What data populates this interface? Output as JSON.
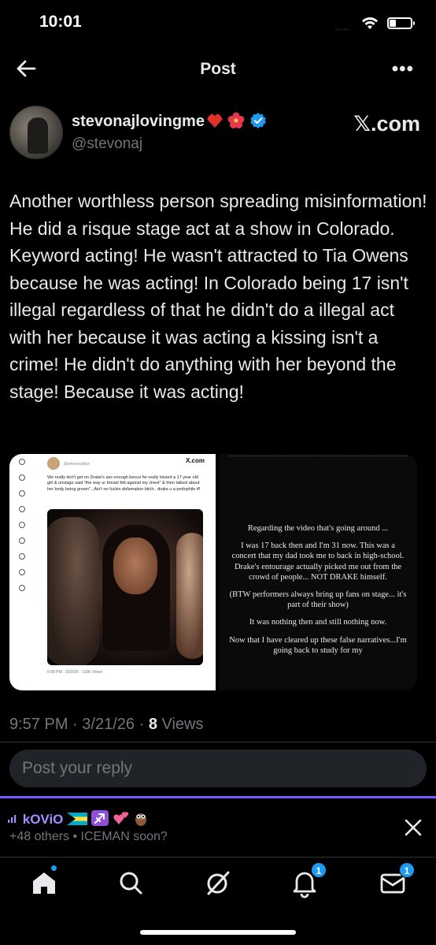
{
  "status_bar": {
    "time": "10:01",
    "signal_dots": "....."
  },
  "nav": {
    "title": "Post",
    "more": "•••"
  },
  "author": {
    "display_name": "stevonajlovingme",
    "handle": "@stevonaj",
    "source_badge": "𝕏.com",
    "name_emojis": [
      "red-heart",
      "hibiscus"
    ]
  },
  "tweet": {
    "text": "Another worthless person spreading misinformation! He did a risque stage act at a show in Colorado. Keyword acting! He wasn't attracted to Tia Owens because he was acting! In Colorado being 17 isn't illegal regardless of that he didn't do a illegal act with her because it was acting a kissing isn't a crime!  He didn't do anything with her beyond the stage! Because it was acting!"
  },
  "media_left": {
    "handle": "@shesroyaltyx",
    "source": "X.com",
    "text": "We really don't get on Drake's ass enough becus he really kissed a 17 year old girl & onstage said \"the way ur breast felt against my chest\" & then talked about her body being grown\"...Ain't no fuckin defamation bitch.. drake u a pedophile tf!",
    "meta": "6:08 PM · 3/20/26 · 116K Views"
  },
  "media_right": {
    "paragraphs": [
      "Regarding the video that's going around ...",
      "I was 17 back then and I'm 31 now. This was a concert that my dad took me to back in high-school. Drake's entourage actually picked me out from the crowd of people... NOT DRAKE himself.",
      "(BTW performers always bring up fans on stage... it's part of their show)",
      "It was nothing then and still nothing now.",
      "Now that I have cleared up these false narratives...I'm going back to study for my"
    ]
  },
  "meta": {
    "time": "9:57 PM",
    "date": "3/21/26",
    "views_count": "8",
    "views_label": "Views",
    "sep": "·"
  },
  "reply": {
    "placeholder": "Post your reply"
  },
  "notification": {
    "user": "kOViO",
    "subtitle": "+48 others • ICEMAN soon?"
  },
  "tabbar": {
    "notifications_badge": "1",
    "messages_badge": "1"
  },
  "colors": {
    "accent": "#1d9bf0",
    "purple": "#7856ff",
    "muted": "#71767b"
  }
}
